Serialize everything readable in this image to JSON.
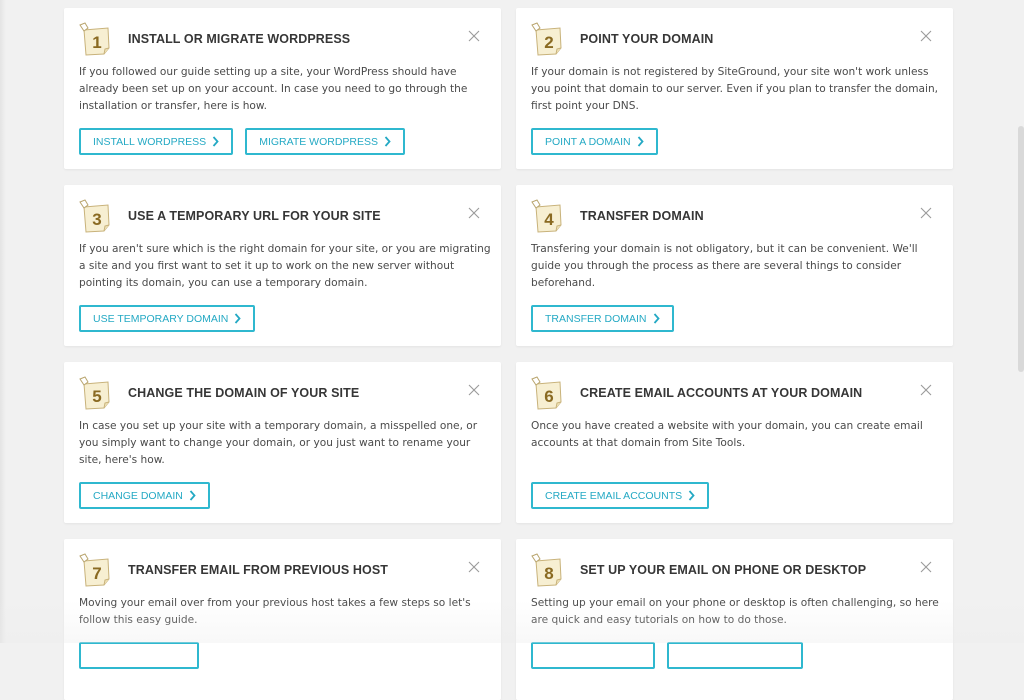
{
  "colors": {
    "accent": "#2fb8cf",
    "badge_fill": "#f7efd2",
    "badge_number": "#8a6a22",
    "background": "#f1f1f1",
    "card": "#ffffff"
  },
  "cards": [
    {
      "number": "1",
      "title": "INSTALL OR MIGRATE WORDPRESS",
      "description": "If you followed our guide setting up a site, your WordPress should have already been set up on your account. In case you need to go through the installation or transfer, here is how.",
      "buttons": [
        {
          "label": "INSTALL WORDPRESS"
        },
        {
          "label": "MIGRATE WORDPRESS"
        }
      ]
    },
    {
      "number": "2",
      "title": "POINT YOUR DOMAIN",
      "description": "If your domain is not registered by SiteGround, your site won't work unless you point that domain to our server. Even if you plan to transfer the domain, first point your DNS.",
      "buttons": [
        {
          "label": "POINT A DOMAIN"
        }
      ]
    },
    {
      "number": "3",
      "title": "USE A TEMPORARY URL FOR YOUR SITE",
      "description": "If you aren't sure which is the right domain for your site, or you are migrating a site and you first want to set it up to work on the new server without pointing its domain, you can use a temporary domain.",
      "buttons": [
        {
          "label": "USE TEMPORARY DOMAIN"
        }
      ]
    },
    {
      "number": "4",
      "title": "TRANSFER DOMAIN",
      "description": "Transfering your domain is not obligatory, but it can be convenient. We'll guide you through the process as there are several things to consider beforehand.",
      "buttons": [
        {
          "label": "TRANSFER DOMAIN"
        }
      ]
    },
    {
      "number": "5",
      "title": "CHANGE THE DOMAIN OF YOUR SITE",
      "description": "In case you set up your site with a temporary domain, a misspelled one, or you simply want to change your domain, or you just want to rename your site, here's how.",
      "buttons": [
        {
          "label": "CHANGE DOMAIN"
        }
      ]
    },
    {
      "number": "6",
      "title": "CREATE EMAIL ACCOUNTS AT YOUR DOMAIN",
      "description": "Once you have created a website with your domain, you can create email accounts at that domain from Site Tools.",
      "buttons": [
        {
          "label": "CREATE EMAIL ACCOUNTS"
        }
      ]
    },
    {
      "number": "7",
      "title": "TRANSFER EMAIL FROM PREVIOUS HOST",
      "description": "Moving your email over from your previous host takes a few steps so let's follow this easy guide.",
      "buttons": [
        {
          "label": ""
        }
      ]
    },
    {
      "number": "8",
      "title": "SET UP YOUR EMAIL ON PHONE OR DESKTOP",
      "description": "Setting up your email on your phone or desktop is often challenging, so here are quick and easy tutorials on how to do those.",
      "buttons": [
        {
          "label": ""
        },
        {
          "label": ""
        }
      ]
    }
  ]
}
